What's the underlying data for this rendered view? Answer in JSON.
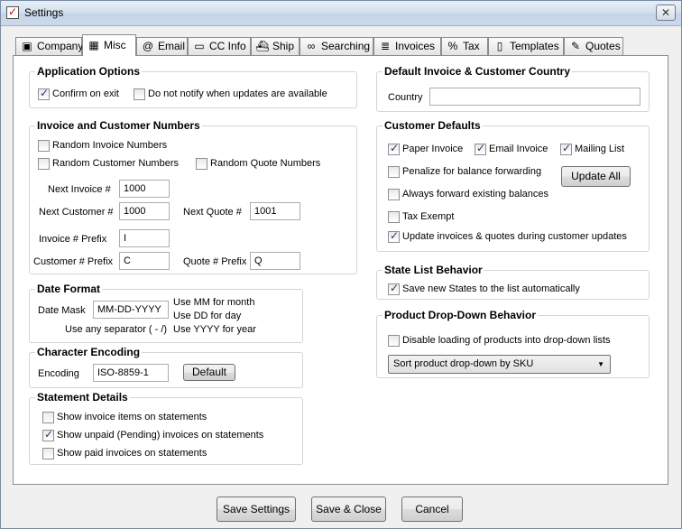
{
  "window": {
    "title": "Settings",
    "close_glyph": "✕"
  },
  "tabs": [
    {
      "label": "Company",
      "icon": "camera-icon",
      "glyph": "▣"
    },
    {
      "label": "Misc",
      "icon": "grid-icon",
      "glyph": "▦"
    },
    {
      "label": "Email",
      "icon": "at-icon",
      "glyph": "@"
    },
    {
      "label": "CC Info",
      "icon": "credit-card-icon",
      "glyph": "▭"
    },
    {
      "label": "Ship",
      "icon": "ship-icon",
      "glyph": "⛴"
    },
    {
      "label": "Searching",
      "icon": "binoculars-icon",
      "glyph": "∞"
    },
    {
      "label": "Invoices",
      "icon": "invoices-icon",
      "glyph": "≣"
    },
    {
      "label": "Tax",
      "icon": "percent-icon",
      "glyph": "%"
    },
    {
      "label": "Templates",
      "icon": "document-icon",
      "glyph": "▯"
    },
    {
      "label": "Quotes",
      "icon": "pencil-icon",
      "glyph": "✎"
    }
  ],
  "app_options": {
    "title": "Application Options",
    "confirm_exit": "Confirm on exit",
    "no_notify": "Do not notify when updates are available"
  },
  "numbers": {
    "title": "Invoice and Customer Numbers",
    "random_invoice": "Random Invoice Numbers",
    "random_customer": "Random Customer Numbers",
    "random_quote": "Random Quote Numbers",
    "next_invoice_label": "Next Invoice #",
    "next_invoice_value": "1000",
    "next_customer_label": "Next Customer #",
    "next_customer_value": "1000",
    "next_quote_label": "Next Quote #",
    "next_quote_value": "1001",
    "invoice_prefix_label": "Invoice # Prefix",
    "invoice_prefix_value": "I",
    "customer_prefix_label": "Customer # Prefix",
    "customer_prefix_value": "C",
    "quote_prefix_label": "Quote # Prefix",
    "quote_prefix_value": "Q"
  },
  "date_format": {
    "title": "Date Format",
    "mask_label": "Date Mask",
    "mask_value": "MM-DD-YYYY",
    "separator_hint": "Use any separator ( - /)",
    "hint_month": "Use MM for month",
    "hint_day": "Use DD for day",
    "hint_year": "Use YYYY for year"
  },
  "encoding": {
    "title": "Character Encoding",
    "label": "Encoding",
    "value": "ISO-8859-1",
    "default_button": "Default"
  },
  "statement": {
    "title": "Statement Details",
    "show_items": "Show invoice items on statements",
    "show_unpaid": "Show unpaid (Pending) invoices on statements",
    "show_paid": "Show paid invoices on statements"
  },
  "country": {
    "title": "Default Invoice & Customer Country",
    "label": "Country",
    "value": ""
  },
  "customer_defaults": {
    "title": "Customer Defaults",
    "paper_invoice": "Paper Invoice",
    "email_invoice": "Email Invoice",
    "mailing_list": "Mailing List",
    "penalize": "Penalize for balance forwarding",
    "update_all": "Update All",
    "always_forward": "Always forward existing balances",
    "tax_exempt": "Tax Exempt",
    "update_invoices": "Update invoices & quotes during customer updates"
  },
  "state_list": {
    "title": "State List Behavior",
    "save_states": "Save new States to the list automatically"
  },
  "product_dropdown": {
    "title": "Product Drop-Down Behavior",
    "disable_loading": "Disable loading of products into drop-down lists",
    "sort_selected": "Sort product drop-down by SKU",
    "arrow_glyph": "▼"
  },
  "footer": {
    "save_settings": "Save Settings",
    "save_close": "Save & Close",
    "cancel": "Cancel"
  }
}
